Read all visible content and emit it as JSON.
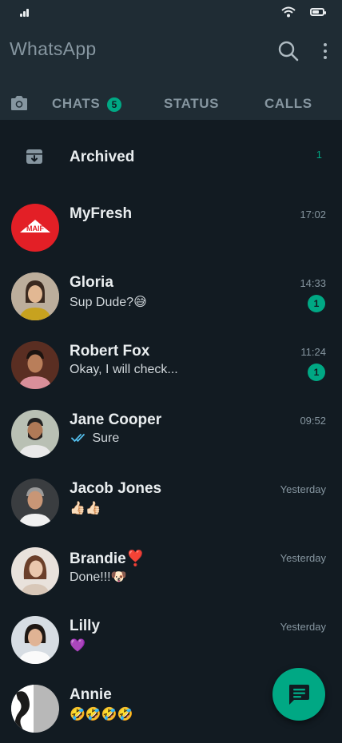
{
  "app": {
    "title": "WhatsApp"
  },
  "icons": {
    "search": "search-icon",
    "more": "more-vert-icon",
    "camera": "camera-icon",
    "archive": "archive-icon",
    "fab": "new-chat-icon",
    "read_receipt": "double-check-icon"
  },
  "colors": {
    "background": "#121b22",
    "header": "#1f2c34",
    "accent": "#00a884",
    "muted_text": "#8696a0",
    "read_tick": "#53bdeb"
  },
  "tabs": {
    "chats": "CHATS",
    "chats_badge": "5",
    "status": "STATUS",
    "calls": "CALLS"
  },
  "archived": {
    "label": "Archived",
    "count": "1"
  },
  "chats": [
    {
      "name": "MyFresh",
      "preview": "",
      "time": "17:02",
      "unread": "",
      "avatar_text": "MAIF"
    },
    {
      "name": "Gloria",
      "preview": "Sup Dude?😅",
      "time": "14:33",
      "unread": "1"
    },
    {
      "name": "Robert Fox",
      "preview": "Okay, I will check...",
      "time": "11:24",
      "unread": "1"
    },
    {
      "name": "Jane Cooper",
      "preview": "Sure",
      "time": "09:52",
      "unread": ""
    },
    {
      "name": "Jacob Jones",
      "preview": "👍🏻👍🏻",
      "time": "Yesterday",
      "unread": ""
    },
    {
      "name": "Brandie❣️",
      "preview": "Done!!!🐶",
      "time": "Yesterday",
      "unread": ""
    },
    {
      "name": "Lilly",
      "preview": "💜",
      "time": "Yesterday",
      "unread": ""
    },
    {
      "name": "Annie",
      "preview": "🤣🤣🤣🤣",
      "time": "",
      "unread": ""
    }
  ]
}
